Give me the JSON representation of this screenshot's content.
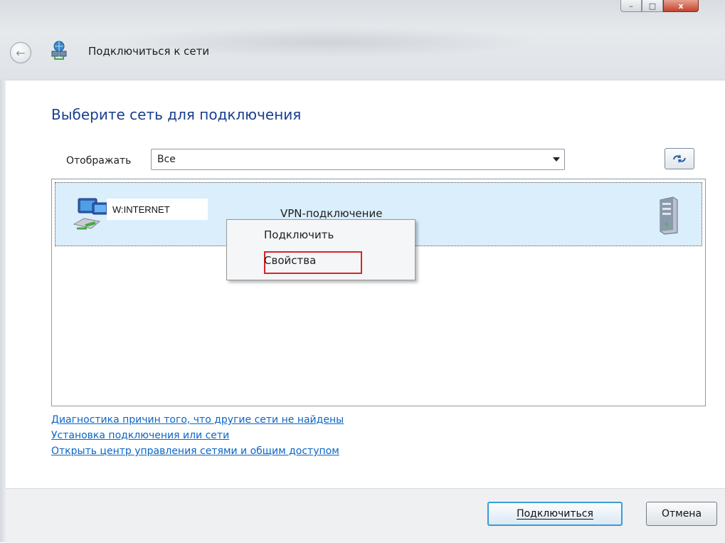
{
  "window": {
    "title": "Подключиться к сети",
    "controls": {
      "minimize": "–",
      "maximize": "□",
      "close": "x"
    }
  },
  "main": {
    "heading": "Выберите сеть для подключения",
    "filter": {
      "label": "Отображать",
      "value": "Все"
    },
    "refresh_icon": "refresh-icon"
  },
  "network_list": {
    "items": [
      {
        "name": "W:INTERNET",
        "type": "VPN-подключение",
        "icon": "network-connection-icon",
        "status_icon": "server-icon"
      }
    ]
  },
  "context_menu": {
    "items": [
      {
        "label": "Подключить"
      },
      {
        "label": "Свойства",
        "highlighted": true
      }
    ],
    "highlight_color": "#d8242a"
  },
  "links": [
    "Диагностика причин того, что другие сети не найдены",
    "Установка подключения или сети",
    "Открыть центр управления сетями и общим доступом"
  ],
  "footer": {
    "connect_label": "Подключиться",
    "cancel_label": "Отмена"
  },
  "colors": {
    "heading": "#1b3f8f",
    "link": "#0b66c6",
    "selection": "#daeefc",
    "default_button_border": "#3c9bd6"
  }
}
